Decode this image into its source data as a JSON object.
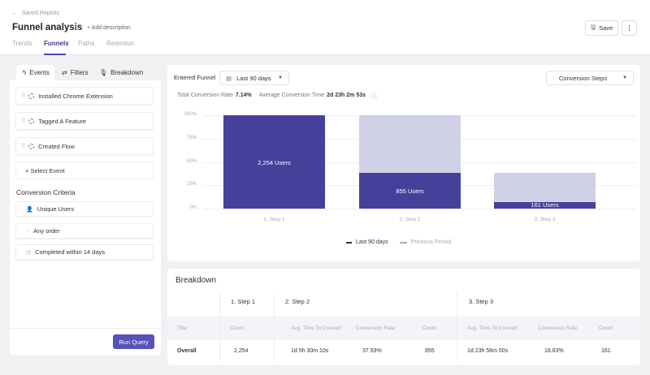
{
  "header": {
    "back_label": "Saved Reports",
    "title": "Funnel analysis",
    "add_description": "+ Add description",
    "save_label": "Save",
    "tabs": [
      {
        "label": "Trends"
      },
      {
        "label": "Funnels",
        "active": true
      },
      {
        "label": "Paths"
      },
      {
        "label": "Retention"
      }
    ]
  },
  "sidebar": {
    "tabs": [
      {
        "label": "Events",
        "icon": "lightning-icon",
        "active": true
      },
      {
        "label": "Filters",
        "icon": "sliders-icon"
      },
      {
        "label": "Breakdown",
        "icon": "microphone-icon"
      }
    ],
    "events": [
      {
        "label": "Installed Chrome Extension"
      },
      {
        "label": "Tagged A Feature"
      },
      {
        "label": "Created Flow"
      }
    ],
    "select_event": "+ Select Event",
    "criteria_title": "Conversion Criteria",
    "criteria": [
      {
        "label": "Unique Users",
        "icon": "user-icon"
      },
      {
        "label": "Any order",
        "icon": "shuffle-icon"
      },
      {
        "label": "Completed within 14 days",
        "icon": "clock-icon"
      }
    ],
    "run_query": "Run Query"
  },
  "chart_panel": {
    "entered_funnel": "Entered Funnel",
    "date_range": "Last 90 days",
    "view_select": "Conversion Steps",
    "total_rate_label": "Total Conversion Rate",
    "total_rate": "7.14%",
    "avg_time_label": "Average Conversion Time",
    "avg_time": "2d 23h 2m 53s"
  },
  "chart_data": {
    "type": "bar",
    "categories": [
      "1. Step 1",
      "2. Step 2",
      "3. Step 3"
    ],
    "yticks": [
      "100%",
      "75%",
      "50%",
      "25%",
      "0%"
    ],
    "ylim": [
      0,
      100
    ],
    "series": [
      {
        "name": "Last 90 days",
        "values": [
          100,
          37.93,
          7.14
        ],
        "labels": [
          "2,254 Users",
          "855 Users",
          "161 Users"
        ],
        "color": "#45419a"
      },
      {
        "name": "Previous Period",
        "values": [
          100,
          100,
          37.93
        ],
        "color": "#d0d0e6"
      }
    ],
    "legend": "bottom",
    "grid": true
  },
  "breakdown": {
    "title": "Breakdown",
    "steps": [
      "1. Step 1",
      "2. Step 2",
      "3. Step 3"
    ],
    "columns": [
      "Title",
      "Count",
      "Avg. Time To Convert",
      "Conversion Rate",
      "Count",
      "Avg. Time To Convert",
      "Conversion Rate",
      "Count"
    ],
    "rows": [
      [
        "Overall",
        "2,254",
        "1d 5h 30m 10s",
        "37.93%",
        "855",
        "1d 23h 56m 50s",
        "18.83%",
        "161"
      ]
    ]
  },
  "colors": {
    "accent": "#5653b8",
    "bar": "#45419a",
    "bar_previous": "#d0d0e6"
  }
}
